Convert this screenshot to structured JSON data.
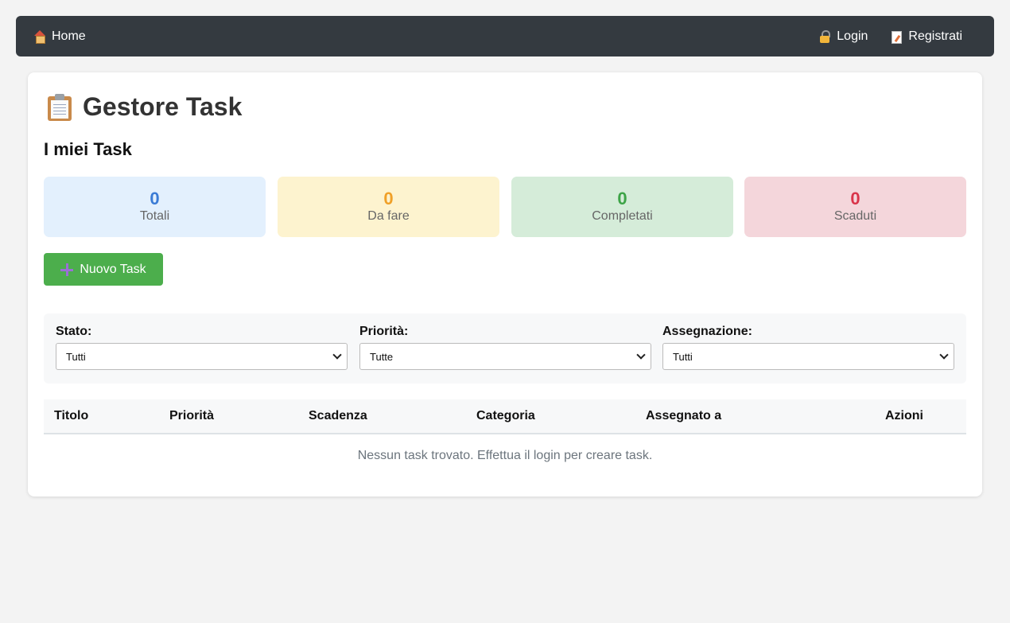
{
  "nav": {
    "home": "Home",
    "login": "Login",
    "register": "Registrati"
  },
  "page": {
    "title": "Gestore Task",
    "section_title": "I miei Task"
  },
  "stats": [
    {
      "value": "0",
      "label": "Totali",
      "color": "#3a7bd5",
      "bg": "#e3f0fd"
    },
    {
      "value": "0",
      "label": "Da fare",
      "color": "#f0a028",
      "bg": "#fdf3cf"
    },
    {
      "value": "0",
      "label": "Completati",
      "color": "#3da447",
      "bg": "#d5ecd9"
    },
    {
      "value": "0",
      "label": "Scaduti",
      "color": "#d9344a",
      "bg": "#f4d6db"
    }
  ],
  "new_task_button": "Nuovo Task",
  "filters": {
    "stato": {
      "label": "Stato:",
      "selected": "Tutti"
    },
    "priorita": {
      "label": "Priorità:",
      "selected": "Tutte"
    },
    "assegnazione": {
      "label": "Assegnazione:",
      "selected": "Tutti"
    }
  },
  "table": {
    "columns": [
      "Titolo",
      "Priorità",
      "Scadenza",
      "Categoria",
      "Assegnato a",
      "Azioni"
    ],
    "empty_message": "Nessun task trovato. Effettua il login per creare task."
  },
  "colors": {
    "navbar": "#343a40",
    "accent_green": "#4cae4c"
  }
}
